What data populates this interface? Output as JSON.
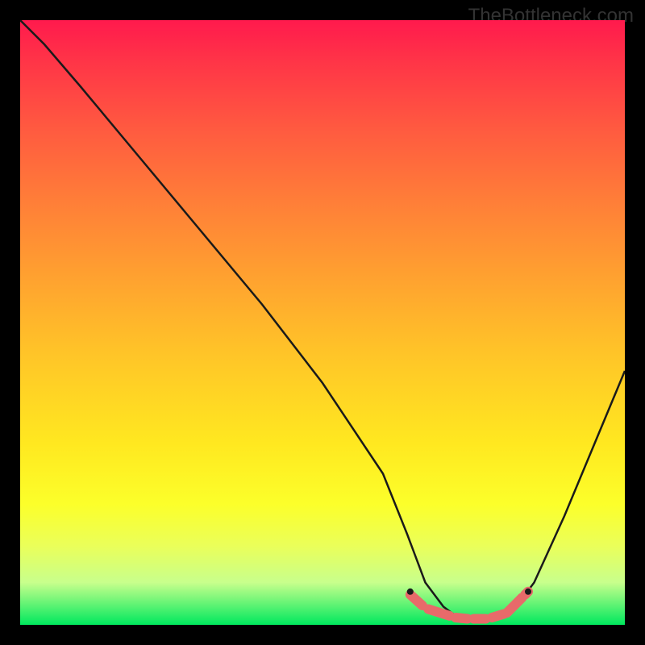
{
  "watermark": "TheBottleneck.com",
  "chart_data": {
    "type": "line",
    "title": "",
    "xlabel": "",
    "ylabel": "",
    "xlim": [
      0,
      100
    ],
    "ylim": [
      0,
      100
    ],
    "series": [
      {
        "name": "bottleneck-curve",
        "x": [
          0,
          4,
          10,
          20,
          30,
          40,
          50,
          60,
          64,
          67,
          70,
          72,
          74,
          76,
          78,
          80,
          82,
          85,
          90,
          95,
          100
        ],
        "y": [
          100,
          96,
          89,
          77,
          65,
          53,
          40,
          25,
          15,
          7,
          3,
          1.5,
          0.8,
          0.6,
          0.8,
          1.5,
          3,
          7,
          18,
          30,
          42
        ]
      }
    ],
    "flat_region": {
      "x_start": 64,
      "x_end": 85
    },
    "markers": [
      {
        "name": "left-dot",
        "x": 64.5,
        "y": 5.5
      },
      {
        "name": "right-dot",
        "x": 84.0,
        "y": 5.5
      }
    ],
    "dash_segments": [
      {
        "x0": 64.5,
        "y0": 5.0,
        "x1": 66.5,
        "y1": 3.2
      },
      {
        "x0": 67.5,
        "y0": 2.6,
        "x1": 71.0,
        "y1": 1.5
      },
      {
        "x0": 72.0,
        "y0": 1.2,
        "x1": 74.0,
        "y1": 1.0
      },
      {
        "x0": 75.0,
        "y0": 1.0,
        "x1": 77.0,
        "y1": 1.0
      },
      {
        "x0": 78.0,
        "y0": 1.2,
        "x1": 80.0,
        "y1": 1.8
      },
      {
        "x0": 80.5,
        "y0": 2.0,
        "x1": 83.0,
        "y1": 4.5
      },
      {
        "x0": 83.5,
        "y0": 5.0,
        "x1": 84.0,
        "y1": 5.5
      }
    ],
    "colors": {
      "curve": "#1a1a1a",
      "dash": "#e86a6a",
      "marker": "#e86a6a",
      "gradient_top": "#ff1a4d",
      "gradient_bottom": "#00e85e"
    }
  }
}
